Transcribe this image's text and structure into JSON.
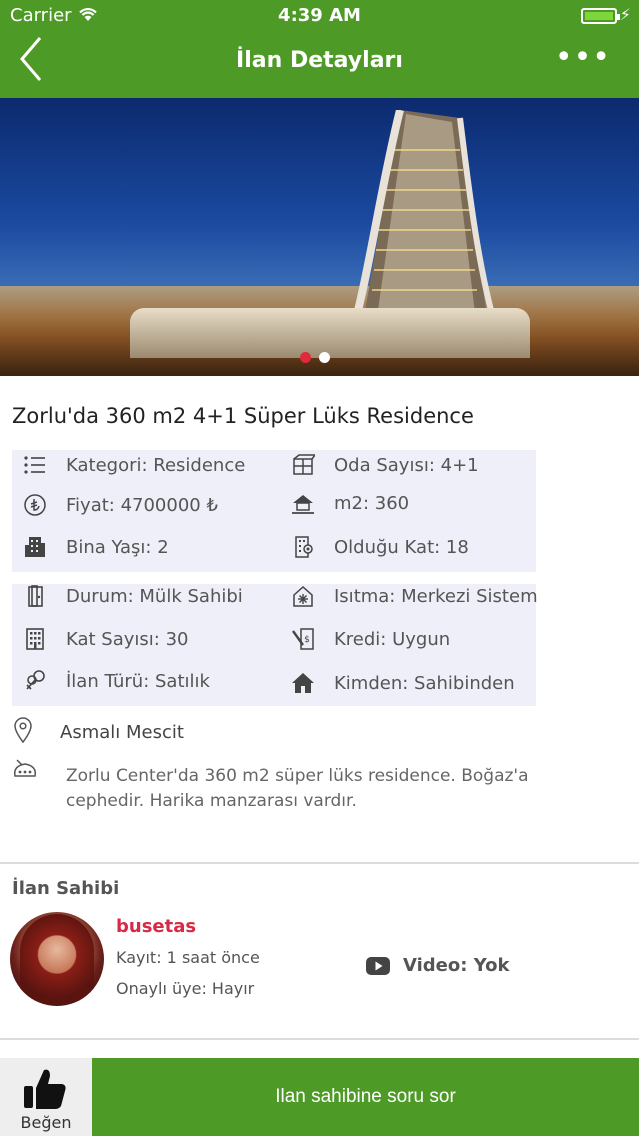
{
  "status": {
    "carrier": "Carrier",
    "time": "4:39 AM"
  },
  "nav": {
    "title": "İlan Detayları",
    "more": "•••"
  },
  "carousel": {
    "count": 2,
    "active": 1
  },
  "listing": {
    "title": "Zorlu'da 360 m2 4+1 Süper Lüks Residence",
    "group1": [
      {
        "icon": "list-icon",
        "label": "Kategori: Residence"
      },
      {
        "icon": "rooms-icon",
        "label": "Oda Sayısı: 4+1"
      },
      {
        "icon": "lira-coin-icon",
        "label": "Fiyat: 4700000 ₺"
      },
      {
        "icon": "house-area-icon",
        "label": "m2: 360"
      },
      {
        "icon": "building-age-icon",
        "label": "Bina Yaşı: 2"
      },
      {
        "icon": "floor-icon",
        "label": "Olduğu Kat: 18"
      }
    ],
    "group2": [
      {
        "icon": "door-icon",
        "label": "Durum: Mülk Sahibi"
      },
      {
        "icon": "heating-icon",
        "label": "Isıtma: Merkezi Sistem"
      },
      {
        "icon": "building-floors-icon",
        "label": "Kat Sayısı: 30"
      },
      {
        "icon": "credit-icon",
        "label": "Kredi: Uygun"
      },
      {
        "icon": "keys-icon",
        "label": "İlan Türü: Satılık"
      },
      {
        "icon": "home-icon",
        "label": "Kimden: Sahibinden"
      }
    ],
    "location": "Asmalı Mescit",
    "description": "Zorlu Center'da 360 m2 süper lüks residence. Boğaz'a cephedir. Harika manzarası vardır."
  },
  "owner": {
    "heading": "İlan Sahibi",
    "username": "busetas",
    "registered": "Kayıt: 1 saat önce",
    "approved": "Onaylı üye: Hayır",
    "video": "Video: Yok"
  },
  "bottom": {
    "like_label": "Beğen",
    "ask_label": "Ilan sahibine soru sor"
  },
  "colors": {
    "brand_green": "#4e9a26",
    "username_red": "#d62a45",
    "grid_bg": "#eeeff8"
  }
}
